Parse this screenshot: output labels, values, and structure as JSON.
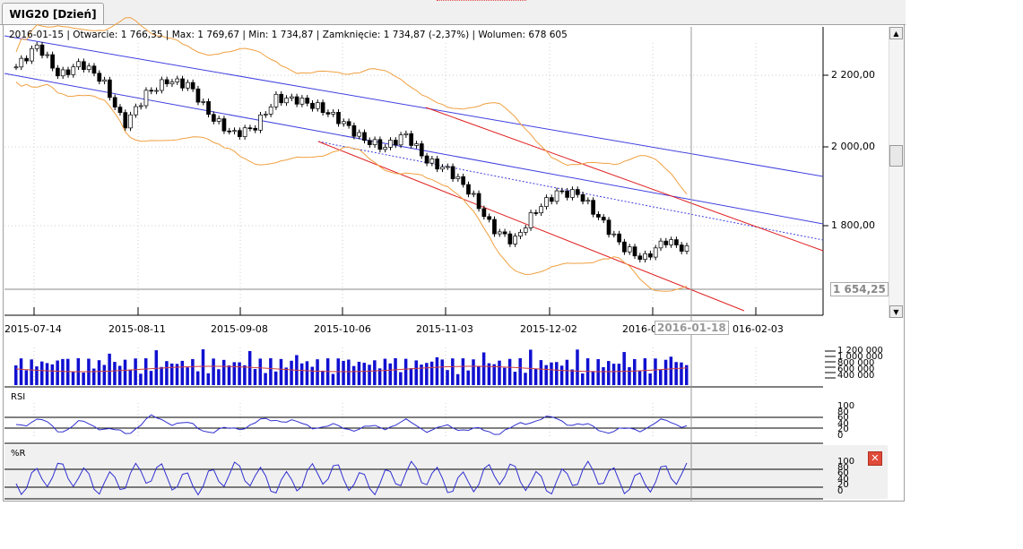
{
  "tab": {
    "label": "WIG20 [Dzień]"
  },
  "info": "2016-01-15 | Otwarcie: 1 766,35 | Max: 1 769,67 | Min: 1 734,87 | Zamknięcie: 1 734,87 (-2,37%)  | Wolumen: 678 605",
  "crosshair": {
    "date": "2016-01-18",
    "price": "1 654,25"
  },
  "price_axis": [
    "2 200,00",
    "2 000,00",
    "1 800,00"
  ],
  "date_axis": [
    "2015-07-14",
    "2015-08-11",
    "2015-09-08",
    "2015-10-06",
    "2015-11-03",
    "2015-12-02",
    "2016-0",
    "016-02-03"
  ],
  "volume_axis": [
    "1 200 000",
    "1 000 000",
    "800 000",
    "600 000",
    "400 000"
  ],
  "rsi": {
    "label": "RSI",
    "axis": [
      "100",
      "80",
      "60",
      "40",
      "20",
      "0"
    ]
  },
  "wr": {
    "label": "%R",
    "axis": [
      "100",
      "80",
      "60",
      "40",
      "20",
      "0"
    ]
  },
  "close_icon": "close-icon",
  "colors": {
    "up": "#ffffff",
    "down": "#000000",
    "bollinger": "#f0a040",
    "channel_blue": "#4040e0",
    "channel_red": "#e02020",
    "volume": "#1010d0",
    "indicator": "#3030d0"
  },
  "chart_data": {
    "type": "candlestick",
    "title": "WIG20 [Dzień]",
    "key_closes": [
      2222,
      2280,
      2197,
      2233,
      2186,
      2067,
      2150,
      2186,
      2174,
      2090,
      2043,
      2060,
      2138,
      2135,
      2114,
      2079,
      2031,
      2007,
      2043,
      1971,
      1948,
      1888,
      1793,
      1757,
      1840,
      1888,
      1885,
      1817,
      1745,
      1710,
      1762,
      1735
    ],
    "ylim": [
      1600,
      2300
    ],
    "xlabel": "",
    "ylabel": ""
  }
}
